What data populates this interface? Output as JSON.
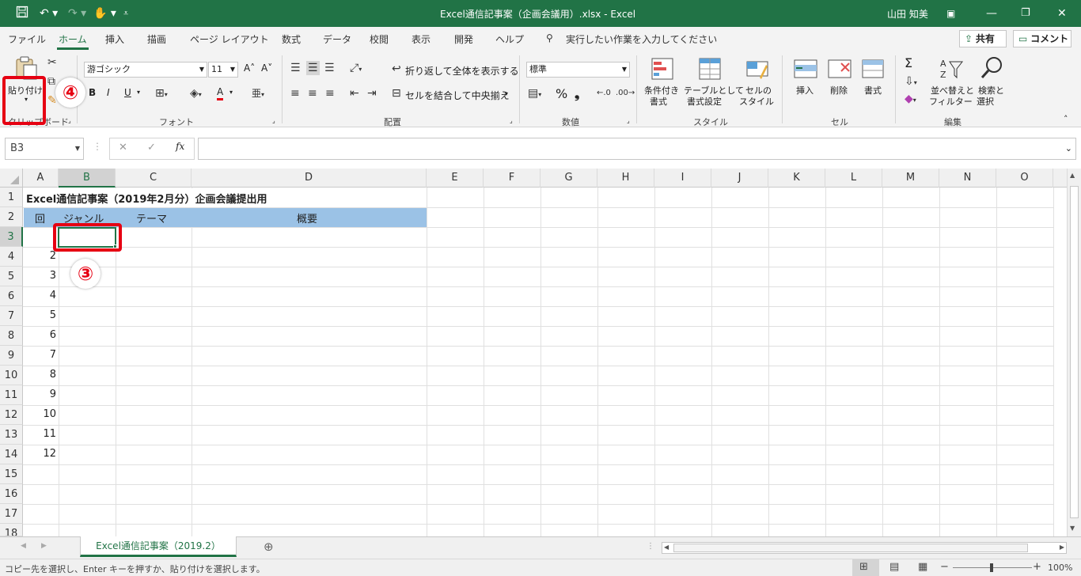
{
  "titlebar": {
    "doc_title": "Excel通信記事案（企画会議用）.xlsx  -  Excel",
    "user": "山田 知美",
    "qat": [
      "save-icon",
      "undo-icon",
      "redo-icon",
      "touch-mode-icon",
      "customize-icon"
    ],
    "window_buttons": [
      "ribbon-display-icon",
      "minimize-icon",
      "restore-icon",
      "close-icon"
    ]
  },
  "tabs": {
    "items": [
      "ファイル",
      "ホーム",
      "挿入",
      "描画",
      "ページ レイアウト",
      "数式",
      "データ",
      "校閲",
      "表示",
      "開発",
      "ヘルプ"
    ],
    "active": "ホーム",
    "tell_me": "実行したい作業を入力してください",
    "share": "共有",
    "comment": "コメント"
  },
  "ribbon": {
    "clipboard": {
      "label": "クリップボード",
      "paste": "貼り付け"
    },
    "font": {
      "label": "フォント",
      "name": "游ゴシック",
      "size": "11",
      "bold": "B",
      "italic": "I",
      "underline": "U",
      "font_color_letter": "A",
      "grow": "A˄",
      "shrink": "A˅"
    },
    "alignment": {
      "label": "配置",
      "wrap": "折り返して全体を表示する",
      "merge": "セルを結合して中央揃え"
    },
    "number": {
      "label": "数値",
      "format": "標準",
      "percent": "%",
      "comma": "❟"
    },
    "styles": {
      "label": "スタイル",
      "conditional_1": "条件付き",
      "conditional_2": "書式",
      "table_1": "テーブルとして",
      "table_2": "書式設定",
      "cell_1": "セルの",
      "cell_2": "スタイル"
    },
    "cells": {
      "label": "セル",
      "insert": "挿入",
      "delete": "削除",
      "format": "書式"
    },
    "editing": {
      "label": "編集",
      "sort_1": "並べ替えと",
      "sort_2": "フィルター",
      "find_1": "検索と",
      "find_2": "選択",
      "sum": "Σ"
    }
  },
  "formula_bar": {
    "name_box": "B3",
    "fx": "fx",
    "cancel": "✕",
    "enter": "✓",
    "value": ""
  },
  "sheet": {
    "columns": [
      "A",
      "B",
      "C",
      "D",
      "E",
      "F",
      "G",
      "H",
      "I",
      "J",
      "K",
      "L",
      "M",
      "N",
      "O"
    ],
    "rows": [
      "1",
      "2",
      "3",
      "4",
      "5",
      "6",
      "7",
      "8",
      "9",
      "10",
      "11",
      "12",
      "13",
      "14",
      "15",
      "16",
      "17",
      "18"
    ],
    "title": "Excel通信記事案（2019年2月分）企画会議提出用",
    "headers": [
      "回",
      "ジャンル",
      "テーマ",
      "概要"
    ],
    "col_a_values": [
      "",
      "2",
      "3",
      "4",
      "5",
      "6",
      "7",
      "8",
      "9",
      "10",
      "11",
      "12"
    ],
    "active_cell": "B3",
    "header_fill": "#9bc2e6"
  },
  "sheet_tabs": {
    "active": "Excel通信記事案（2019.2）",
    "add": "⊕"
  },
  "status": {
    "message": "コピー先を選択し、Enter キーを押すか、貼り付けを選択します。",
    "zoom": "100%"
  },
  "annotations": {
    "step3": "③",
    "step4": "④",
    "color": "#e60012"
  },
  "theme": {
    "accent": "#217346"
  }
}
